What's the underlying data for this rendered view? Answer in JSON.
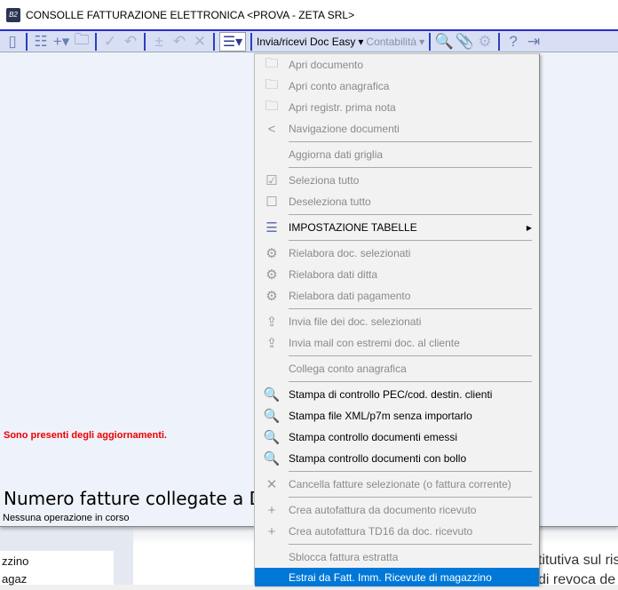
{
  "window": {
    "title": "CONSOLLE FATTURAZIONE ELETTRONICA <PROVA - ZETA SRL>",
    "app_icon": "B2"
  },
  "toolbar": {
    "doc_easy": "Invia/ricevi Doc Easy",
    "contabilita": "Contabilità"
  },
  "body": {
    "update_notice": "Sono presenti degli aggiornamenti.",
    "linked_invoices": "Numero fatture collegate a DocEasy",
    "status": "Nessuna operazione in corso"
  },
  "background": {
    "list": [
      "zzino",
      "agaz"
    ],
    "text": [
      "titutiva sul ris",
      "di revoca de"
    ]
  },
  "menu": [
    {
      "label": "Apri documento",
      "icon": "folder-icon",
      "sym": "🗀",
      "enabled": false
    },
    {
      "label": "Apri conto anagrafica",
      "icon": "folder-icon",
      "sym": "🗀",
      "enabled": false
    },
    {
      "label": "Apri registr. prima nota",
      "icon": "folder-icon",
      "sym": "🗀",
      "enabled": false
    },
    {
      "label": "Navigazione documenti",
      "icon": "share-icon",
      "sym": "<",
      "enabled": false
    },
    {
      "sep": true
    },
    {
      "label": "Aggiorna dati griglia",
      "icon": "",
      "sym": "",
      "enabled": false
    },
    {
      "sep": true
    },
    {
      "label": "Seleziona tutto",
      "icon": "checkbox-checked-icon",
      "sym": "☑",
      "enabled": false
    },
    {
      "label": "Deseleziona tutto",
      "icon": "checkbox-empty-icon",
      "sym": "☐",
      "enabled": false
    },
    {
      "sep": true
    },
    {
      "label": "IMPOSTAZIONE TABELLE",
      "icon": "hamburger-icon",
      "sym": "☰",
      "enabled": true,
      "submenu": true
    },
    {
      "sep": true
    },
    {
      "label": "Rielabora doc. selezionati",
      "icon": "gears-icon",
      "sym": "⚙",
      "enabled": false
    },
    {
      "label": "Rielabora dati ditta",
      "icon": "gears-icon",
      "sym": "⚙",
      "enabled": false
    },
    {
      "label": "Rielabora dati pagamento",
      "icon": "gears-icon",
      "sym": "⚙",
      "enabled": false
    },
    {
      "sep": true
    },
    {
      "label": "Invia file dei doc. selezionati",
      "icon": "upload-icon",
      "sym": "⇪",
      "enabled": false
    },
    {
      "label": "Invia mail con estremi doc. al cliente",
      "icon": "upload-icon",
      "sym": "⇪",
      "enabled": false
    },
    {
      "sep": true
    },
    {
      "label": "Collega conto anagrafica",
      "icon": "",
      "sym": "",
      "enabled": false
    },
    {
      "sep": true
    },
    {
      "label": "Stampa di controllo PEC/cod. destin. clienti",
      "icon": "print-preview-icon",
      "sym": "🔍",
      "enabled": true
    },
    {
      "label": "Stampa file XML/p7m senza importarlo",
      "icon": "print-preview-icon",
      "sym": "🔍",
      "enabled": true
    },
    {
      "label": "Stampa controllo documenti emessi",
      "icon": "print-preview-icon",
      "sym": "🔍",
      "enabled": true
    },
    {
      "label": "Stampa controllo documenti con bollo",
      "icon": "print-preview-icon",
      "sym": "🔍",
      "enabled": true
    },
    {
      "sep": true
    },
    {
      "label": "Cancella fatture selezionate (o fattura corrente)",
      "icon": "close-icon",
      "sym": "✕",
      "enabled": false
    },
    {
      "sep": true
    },
    {
      "label": "Crea autofattura da documento ricevuto",
      "icon": "plus-icon",
      "sym": "+",
      "enabled": false
    },
    {
      "label": "Crea autofattura TD16 da doc. ricevuto",
      "icon": "plus-icon",
      "sym": "+",
      "enabled": false
    },
    {
      "sep": true
    },
    {
      "label": "Sblocca fattura estratta",
      "icon": "",
      "sym": "",
      "enabled": false
    },
    {
      "label": "Estrai da Fatt. Imm. Ricevute di magazzino",
      "icon": "",
      "sym": "",
      "enabled": true,
      "highlighted": true
    }
  ]
}
